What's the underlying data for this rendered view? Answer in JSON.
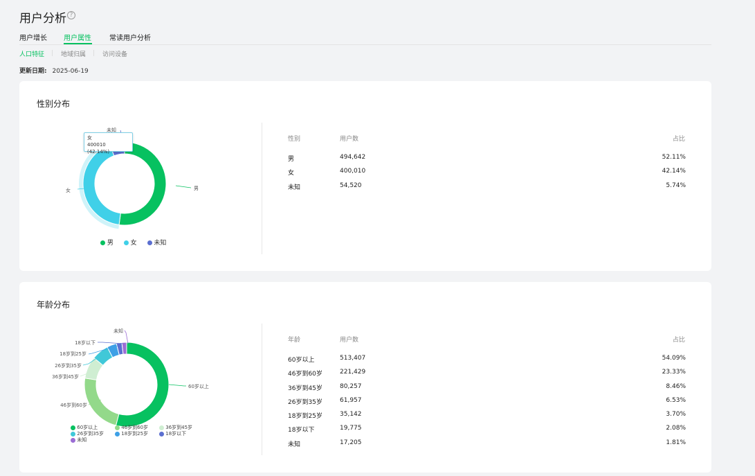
{
  "header": {
    "title": "用户分析",
    "help_icon": "question-circle-icon"
  },
  "tabs": [
    {
      "label": "用户增长",
      "active": false
    },
    {
      "label": "用户属性",
      "active": true
    },
    {
      "label": "常读用户分析",
      "active": false
    }
  ],
  "subtabs": [
    {
      "label": "人口特征",
      "active": true
    },
    {
      "label": "地域归属",
      "active": false
    },
    {
      "label": "访问设备",
      "active": false
    }
  ],
  "update": {
    "label": "更新日期:",
    "date": "2025-06-19"
  },
  "colors": {
    "accent": "#07c160"
  },
  "gender": {
    "title": "性别分布",
    "headers": {
      "c1": "性别",
      "c2": "用户数",
      "c3": "占比"
    },
    "rows": [
      {
        "name": "男",
        "users": "494,642",
        "pct": "52.11%"
      },
      {
        "name": "女",
        "users": "400,010",
        "pct": "42.14%"
      },
      {
        "name": "未知",
        "users": "54,520",
        "pct": "5.74%"
      }
    ],
    "tooltip": {
      "name": "女",
      "value": "400010 (42.14%)"
    },
    "legend": [
      "男",
      "女",
      "未知"
    ],
    "slice_labels": [
      "男",
      "女",
      "未知"
    ]
  },
  "age": {
    "title": "年龄分布",
    "headers": {
      "c1": "年龄",
      "c2": "用户数",
      "c3": "占比"
    },
    "rows": [
      {
        "name": "60岁以上",
        "users": "513,407",
        "pct": "54.09%"
      },
      {
        "name": "46岁到60岁",
        "users": "221,429",
        "pct": "23.33%"
      },
      {
        "name": "36岁到45岁",
        "users": "80,257",
        "pct": "8.46%"
      },
      {
        "name": "26岁到35岁",
        "users": "61,957",
        "pct": "6.53%"
      },
      {
        "name": "18岁到25岁",
        "users": "35,142",
        "pct": "3.70%"
      },
      {
        "name": "18岁以下",
        "users": "19,775",
        "pct": "2.08%"
      },
      {
        "name": "未知",
        "users": "17,205",
        "pct": "1.81%"
      }
    ],
    "legend": [
      "60岁以上",
      "46岁到60岁",
      "36岁到45岁",
      "26岁到35岁",
      "18岁到25岁",
      "18岁以下",
      "未知"
    ]
  },
  "chart_data": [
    {
      "type": "pie",
      "categories": [
        "男",
        "女",
        "未知"
      ],
      "values": [
        494642,
        400010,
        54520
      ],
      "percentages": [
        52.11,
        42.14,
        5.74
      ],
      "colors": [
        "#07c160",
        "#40d0e8",
        "#5b6fd0"
      ],
      "title": "性别分布",
      "legend": "bottom"
    },
    {
      "type": "pie",
      "categories": [
        "60岁以上",
        "46岁到60岁",
        "36岁到45岁",
        "26岁到35岁",
        "18岁到25岁",
        "18岁以下",
        "未知"
      ],
      "values": [
        513407,
        221429,
        80257,
        61957,
        35142,
        19775,
        17205
      ],
      "percentages": [
        54.09,
        23.33,
        8.46,
        6.53,
        3.7,
        2.08,
        1.81
      ],
      "colors": [
        "#07c160",
        "#93d98a",
        "#cfeed2",
        "#40c8d8",
        "#3ea0e6",
        "#5b6fd0",
        "#9b6dd4"
      ],
      "title": "年龄分布",
      "legend": "bottom"
    }
  ]
}
